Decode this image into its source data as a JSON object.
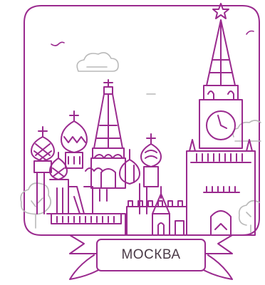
{
  "colors": {
    "accent": "#9a2a8e",
    "line": "#9a2a8e",
    "cloud": "#b9b9b9",
    "background": "#ffffff"
  },
  "banner": {
    "label": "МОСКВА"
  },
  "illustration": {
    "subject": "moscow-kremlin-icon",
    "elements": [
      "saint-basils-cathedral-icon",
      "spasskaya-tower-icon",
      "kremlin-star-icon",
      "cloud-icon",
      "tree-icon",
      "bird-icon"
    ]
  }
}
